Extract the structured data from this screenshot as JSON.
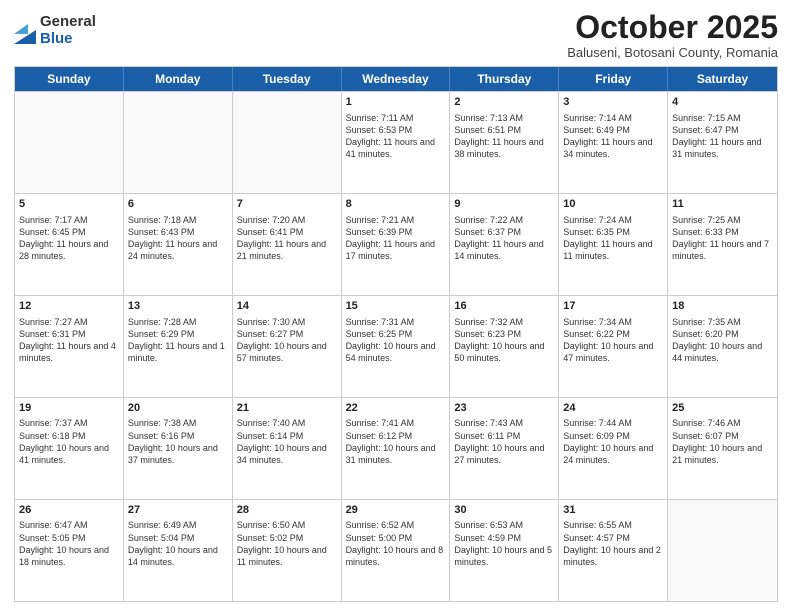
{
  "logo": {
    "general": "General",
    "blue": "Blue"
  },
  "header": {
    "month": "October 2025",
    "location": "Baluseni, Botosani County, Romania"
  },
  "days": [
    "Sunday",
    "Monday",
    "Tuesday",
    "Wednesday",
    "Thursday",
    "Friday",
    "Saturday"
  ],
  "weeks": [
    [
      {
        "day": "",
        "content": ""
      },
      {
        "day": "",
        "content": ""
      },
      {
        "day": "",
        "content": ""
      },
      {
        "day": "1",
        "content": "Sunrise: 7:11 AM\nSunset: 6:53 PM\nDaylight: 11 hours and 41 minutes."
      },
      {
        "day": "2",
        "content": "Sunrise: 7:13 AM\nSunset: 6:51 PM\nDaylight: 11 hours and 38 minutes."
      },
      {
        "day": "3",
        "content": "Sunrise: 7:14 AM\nSunset: 6:49 PM\nDaylight: 11 hours and 34 minutes."
      },
      {
        "day": "4",
        "content": "Sunrise: 7:15 AM\nSunset: 6:47 PM\nDaylight: 11 hours and 31 minutes."
      }
    ],
    [
      {
        "day": "5",
        "content": "Sunrise: 7:17 AM\nSunset: 6:45 PM\nDaylight: 11 hours and 28 minutes."
      },
      {
        "day": "6",
        "content": "Sunrise: 7:18 AM\nSunset: 6:43 PM\nDaylight: 11 hours and 24 minutes."
      },
      {
        "day": "7",
        "content": "Sunrise: 7:20 AM\nSunset: 6:41 PM\nDaylight: 11 hours and 21 minutes."
      },
      {
        "day": "8",
        "content": "Sunrise: 7:21 AM\nSunset: 6:39 PM\nDaylight: 11 hours and 17 minutes."
      },
      {
        "day": "9",
        "content": "Sunrise: 7:22 AM\nSunset: 6:37 PM\nDaylight: 11 hours and 14 minutes."
      },
      {
        "day": "10",
        "content": "Sunrise: 7:24 AM\nSunset: 6:35 PM\nDaylight: 11 hours and 11 minutes."
      },
      {
        "day": "11",
        "content": "Sunrise: 7:25 AM\nSunset: 6:33 PM\nDaylight: 11 hours and 7 minutes."
      }
    ],
    [
      {
        "day": "12",
        "content": "Sunrise: 7:27 AM\nSunset: 6:31 PM\nDaylight: 11 hours and 4 minutes."
      },
      {
        "day": "13",
        "content": "Sunrise: 7:28 AM\nSunset: 6:29 PM\nDaylight: 11 hours and 1 minute."
      },
      {
        "day": "14",
        "content": "Sunrise: 7:30 AM\nSunset: 6:27 PM\nDaylight: 10 hours and 57 minutes."
      },
      {
        "day": "15",
        "content": "Sunrise: 7:31 AM\nSunset: 6:25 PM\nDaylight: 10 hours and 54 minutes."
      },
      {
        "day": "16",
        "content": "Sunrise: 7:32 AM\nSunset: 6:23 PM\nDaylight: 10 hours and 50 minutes."
      },
      {
        "day": "17",
        "content": "Sunrise: 7:34 AM\nSunset: 6:22 PM\nDaylight: 10 hours and 47 minutes."
      },
      {
        "day": "18",
        "content": "Sunrise: 7:35 AM\nSunset: 6:20 PM\nDaylight: 10 hours and 44 minutes."
      }
    ],
    [
      {
        "day": "19",
        "content": "Sunrise: 7:37 AM\nSunset: 6:18 PM\nDaylight: 10 hours and 41 minutes."
      },
      {
        "day": "20",
        "content": "Sunrise: 7:38 AM\nSunset: 6:16 PM\nDaylight: 10 hours and 37 minutes."
      },
      {
        "day": "21",
        "content": "Sunrise: 7:40 AM\nSunset: 6:14 PM\nDaylight: 10 hours and 34 minutes."
      },
      {
        "day": "22",
        "content": "Sunrise: 7:41 AM\nSunset: 6:12 PM\nDaylight: 10 hours and 31 minutes."
      },
      {
        "day": "23",
        "content": "Sunrise: 7:43 AM\nSunset: 6:11 PM\nDaylight: 10 hours and 27 minutes."
      },
      {
        "day": "24",
        "content": "Sunrise: 7:44 AM\nSunset: 6:09 PM\nDaylight: 10 hours and 24 minutes."
      },
      {
        "day": "25",
        "content": "Sunrise: 7:46 AM\nSunset: 6:07 PM\nDaylight: 10 hours and 21 minutes."
      }
    ],
    [
      {
        "day": "26",
        "content": "Sunrise: 6:47 AM\nSunset: 5:05 PM\nDaylight: 10 hours and 18 minutes."
      },
      {
        "day": "27",
        "content": "Sunrise: 6:49 AM\nSunset: 5:04 PM\nDaylight: 10 hours and 14 minutes."
      },
      {
        "day": "28",
        "content": "Sunrise: 6:50 AM\nSunset: 5:02 PM\nDaylight: 10 hours and 11 minutes."
      },
      {
        "day": "29",
        "content": "Sunrise: 6:52 AM\nSunset: 5:00 PM\nDaylight: 10 hours and 8 minutes."
      },
      {
        "day": "30",
        "content": "Sunrise: 6:53 AM\nSunset: 4:59 PM\nDaylight: 10 hours and 5 minutes."
      },
      {
        "day": "31",
        "content": "Sunrise: 6:55 AM\nSunset: 4:57 PM\nDaylight: 10 hours and 2 minutes."
      },
      {
        "day": "",
        "content": ""
      }
    ]
  ]
}
